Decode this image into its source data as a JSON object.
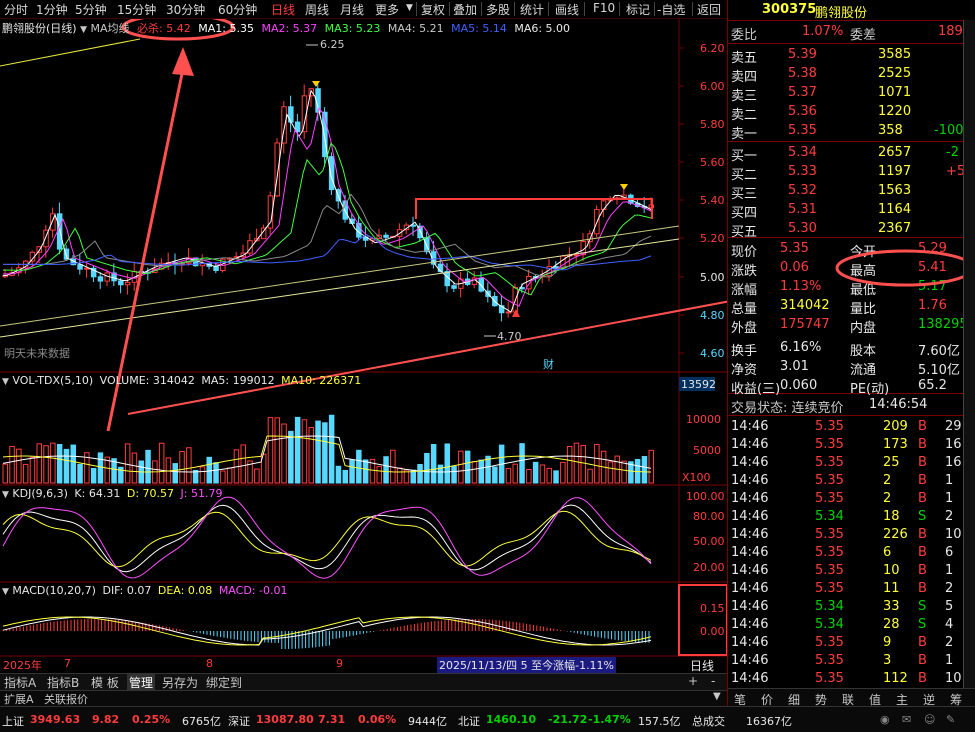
{
  "toolbar": {
    "items": [
      "分时",
      "1分钟",
      "5分钟",
      "15分钟",
      "30分钟",
      "60分钟",
      "日线",
      "周线",
      "月线",
      "更多"
    ],
    "active": "日线",
    "right_items": [
      "复权",
      "叠加",
      "多股",
      "统计",
      "画线",
      "F10",
      "标记",
      "-自选",
      "返回"
    ]
  },
  "price_header": {
    "title": "鹏翎股份(日线)",
    "ma_label": "MA均线",
    "special_label": "必杀: 5.42",
    "ma": [
      {
        "label": "MA1: 5.35",
        "color": "#ffffff"
      },
      {
        "label": "MA2: 5.37",
        "color": "#ff40ff"
      },
      {
        "label": "MA3: 5.23",
        "color": "#40ff40"
      },
      {
        "label": "MA4: 5.21",
        "color": "#c8c8c8"
      },
      {
        "label": "MA5: 5.14",
        "color": "#4060ff"
      },
      {
        "label": "MA6: 5.00",
        "color": "#e8e8e8"
      }
    ],
    "watermark": "明天未来数据",
    "annot_high": "6.25",
    "annot_low": "4.70",
    "annot_cai": "财"
  },
  "price_axis": [
    "6.20",
    "6.00",
    "5.80",
    "5.60",
    "5.40",
    "5.20",
    "5.00",
    "4.80",
    "4.60"
  ],
  "vol_header": {
    "name": "VOL-TDX(5,10)",
    "volume": "VOLUME: 314042",
    "ma5": "MA5: 199012",
    "ma10": "MA10: 226371"
  },
  "vol_axis": [
    "13592",
    "10000",
    "5000",
    "X100"
  ],
  "kdj_header": {
    "name": "KDJ(9,6,3)",
    "k": "K: 64.31",
    "d": "D: 70.57",
    "j": "J: 51.79"
  },
  "kdj_axis": [
    "100.00",
    "80.00",
    "50.00",
    "20.00"
  ],
  "macd_header": {
    "name": "MACD(10,20,7)",
    "dif": "DIF: 0.07",
    "dea": "DEA: 0.08",
    "macd": "MACD: -0.01"
  },
  "macd_axis": [
    "0.15",
    "0.00"
  ],
  "date_axis": {
    "year": "2025年",
    "months": [
      "7",
      "8",
      "9"
    ],
    "info": "2025/11/13/四 5 至今涨幅-1.11%",
    "period": "日线"
  },
  "bottom_tabs": [
    "指标A",
    "指标B",
    "模 板",
    "管理",
    "另存为",
    "绑定到"
  ],
  "bottom_tab_selected": "管理",
  "ext_tabs": [
    "扩展A",
    "关联报价"
  ],
  "stock": {
    "code": "300375",
    "name": "鹏翎股份"
  },
  "weibi": {
    "l1": "委比",
    "v1": "1.07%",
    "l2": "委差",
    "v2": "189"
  },
  "asks": [
    {
      "label": "卖五",
      "price": "5.39",
      "vol": "3585",
      "chg": ""
    },
    {
      "label": "卖四",
      "price": "5.38",
      "vol": "2525",
      "chg": ""
    },
    {
      "label": "卖三",
      "price": "5.37",
      "vol": "1071",
      "chg": ""
    },
    {
      "label": "卖二",
      "price": "5.36",
      "vol": "1220",
      "chg": ""
    },
    {
      "label": "卖一",
      "price": "5.35",
      "vol": "358",
      "chg": "-100"
    }
  ],
  "bids": [
    {
      "label": "买一",
      "price": "5.34",
      "vol": "2657",
      "chg": "-2"
    },
    {
      "label": "买二",
      "price": "5.33",
      "vol": "1197",
      "chg": "+5"
    },
    {
      "label": "买三",
      "price": "5.32",
      "vol": "1563",
      "chg": ""
    },
    {
      "label": "买四",
      "price": "5.31",
      "vol": "1164",
      "chg": ""
    },
    {
      "label": "买五",
      "price": "5.30",
      "vol": "2367",
      "chg": ""
    }
  ],
  "quote": [
    {
      "l1": "现价",
      "v1": "5.35",
      "l2": "今开",
      "v2": "5.29"
    },
    {
      "l1": "涨跌",
      "v1": "0.06",
      "l2": "最高",
      "v2": "5.41"
    },
    {
      "l1": "涨幅",
      "v1": "1.13%",
      "l2": "最低",
      "v2": "5.17"
    },
    {
      "l1": "总量",
      "v1": "314042",
      "l2": "量比",
      "v2": "1.76"
    },
    {
      "l1": "外盘",
      "v1": "175747",
      "l2": "内盘",
      "v2": "138295"
    },
    {
      "l1": "换手",
      "v1": "6.16%",
      "l2": "股本",
      "v2": "7.60亿"
    },
    {
      "l1": "净资",
      "v1": "3.01",
      "l2": "流通",
      "v2": "5.10亿"
    },
    {
      "l1": "收益(三)",
      "v1": "0.060",
      "l2": "PE(动)",
      "v2": "65.2"
    }
  ],
  "trade_status": {
    "label": "交易状态: 连续竞价",
    "time": "14:46:54"
  },
  "ticks": [
    {
      "t": "14:46",
      "p": "5.35",
      "v": "209",
      "s": "B",
      "n": "29"
    },
    {
      "t": "14:46",
      "p": "5.35",
      "v": "173",
      "s": "B",
      "n": "16"
    },
    {
      "t": "14:46",
      "p": "5.35",
      "v": "25",
      "s": "B",
      "n": "16"
    },
    {
      "t": "14:46",
      "p": "5.35",
      "v": "2",
      "s": "B",
      "n": "1"
    },
    {
      "t": "14:46",
      "p": "5.35",
      "v": "2",
      "s": "B",
      "n": "1"
    },
    {
      "t": "14:46",
      "p": "5.34",
      "v": "18",
      "s": "S",
      "n": "2"
    },
    {
      "t": "14:46",
      "p": "5.35",
      "v": "226",
      "s": "B",
      "n": "10"
    },
    {
      "t": "14:46",
      "p": "5.35",
      "v": "6",
      "s": "B",
      "n": "6"
    },
    {
      "t": "14:46",
      "p": "5.35",
      "v": "10",
      "s": "B",
      "n": "1"
    },
    {
      "t": "14:46",
      "p": "5.35",
      "v": "11",
      "s": "B",
      "n": "2"
    },
    {
      "t": "14:46",
      "p": "5.34",
      "v": "33",
      "s": "S",
      "n": "5"
    },
    {
      "t": "14:46",
      "p": "5.34",
      "v": "28",
      "s": "S",
      "n": "4"
    },
    {
      "t": "14:46",
      "p": "5.35",
      "v": "9",
      "s": "B",
      "n": "2"
    },
    {
      "t": "14:46",
      "p": "5.35",
      "v": "3",
      "s": "B",
      "n": "1"
    },
    {
      "t": "14:46",
      "p": "5.35",
      "v": "112",
      "s": "B",
      "n": "10"
    }
  ],
  "side_tabs": [
    "笔",
    "价",
    "细",
    "势",
    "联",
    "值",
    "主",
    "逆",
    "筹"
  ],
  "status_bar": [
    {
      "name": "上证",
      "val": "3949.63",
      "chg": "9.82",
      "pct": "0.25%",
      "amt": "6765亿",
      "color": "#ff3c3c"
    },
    {
      "name": "深证",
      "val": "13087.80",
      "chg": "7.31",
      "pct": "0.06%",
      "amt": "9444亿",
      "color": "#ff3c3c"
    },
    {
      "name": "北证",
      "val": "1460.10",
      "chg": "-21.72",
      "pct": "-1.47%",
      "amt": "157.5亿",
      "color": "#00d200"
    }
  ],
  "status_total": {
    "label": "总成交",
    "val": "16367亿"
  },
  "colors": {
    "up": "#ff3c3c",
    "down": "#58d8ff",
    "panel_border": "#7a0000",
    "bg": "#000000"
  }
}
